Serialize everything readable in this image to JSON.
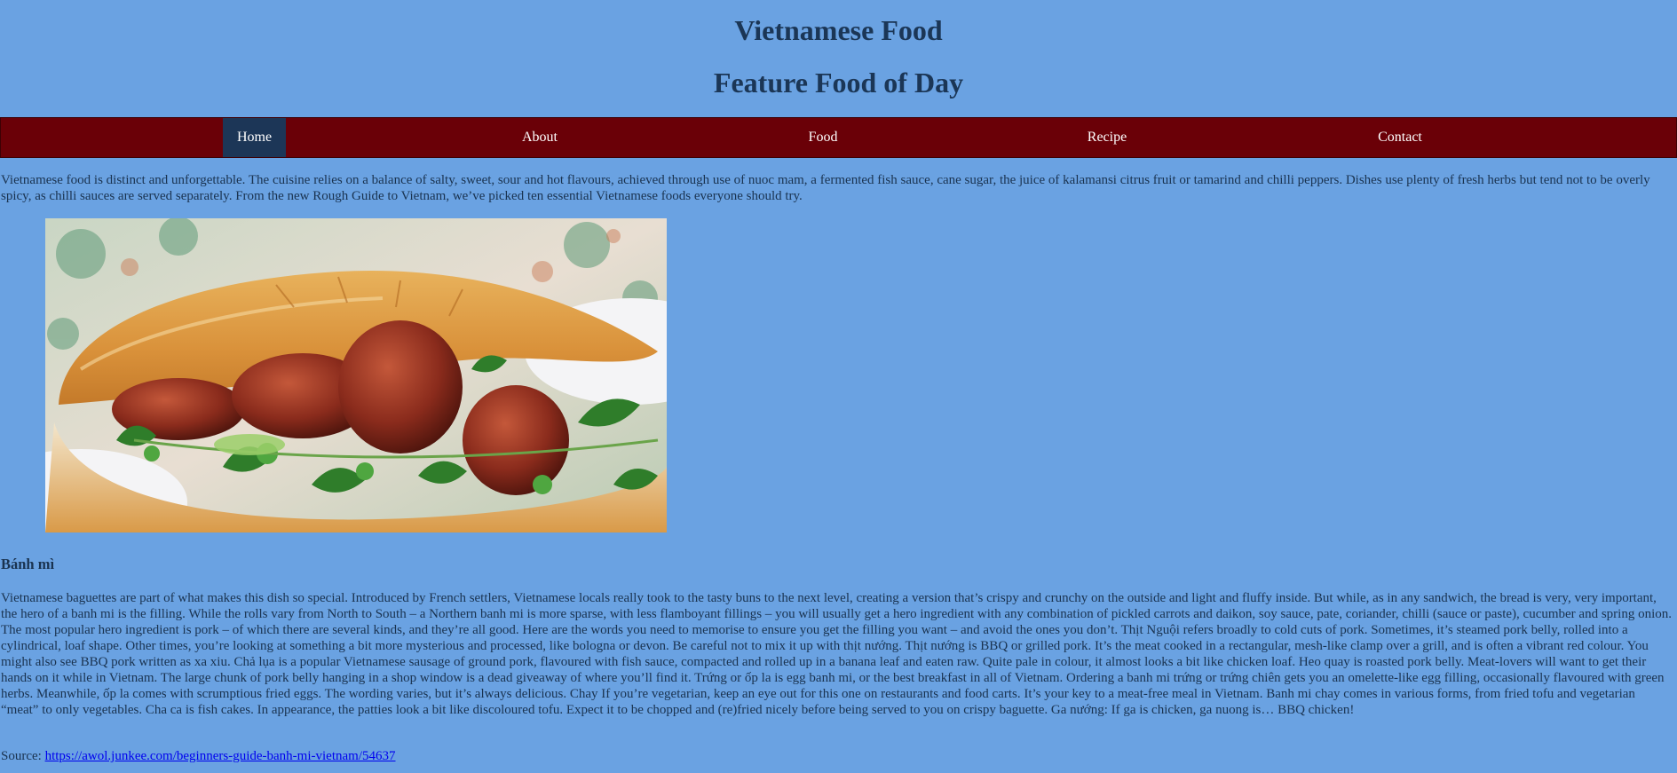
{
  "header": {
    "title": "Vietnamese Food",
    "subtitle": "Feature Food of Day"
  },
  "nav": {
    "items": [
      {
        "label": "Home",
        "active": true
      },
      {
        "label": "About",
        "active": false
      },
      {
        "label": "Food",
        "active": false
      },
      {
        "label": "Recipe",
        "active": false
      },
      {
        "label": "Contact",
        "active": false
      }
    ]
  },
  "intro": "Vietnamese food is distinct and unforgettable. The cuisine relies on a balance of salty, sweet, sour and hot flavours, achieved through use of nuoc mam, a fermented fish sauce, cane sugar, the juice of kalamansi citrus fruit or tamarind and chilli peppers. Dishes use plenty of fresh herbs but tend not to be overly spicy, as chilli sauces are served separately. From the new Rough Guide to Vietnam, we’ve picked ten essential Vietnamese foods everyone should try.",
  "dish": {
    "name": "Bánh mì",
    "description": "Vietnamese baguettes are part of what makes this dish so special. Introduced by French settlers, Vietnamese locals really took to the tasty buns to the next level, creating a version that’s crispy and crunchy on the outside and light and fluffy inside. But while, as in any sandwich, the bread is very, very important, the hero of a banh mi is the filling. While the rolls vary from North to South – a Northern banh mi is more sparse, with less flamboyant fillings – you will usually get a hero ingredient with any combination of pickled carrots and daikon, soy sauce, pate, coriander, chilli (sauce or paste), cucumber and spring onion. The most popular hero ingredient is pork – of which there are several kinds, and they’re all good. Here are the words you need to memorise to ensure you get the filling you want – and avoid the ones you don’t. Thịt Nguội refers broadly to cold cuts of pork. Sometimes, it’s steamed pork belly, rolled into a cylindrical, loaf shape. Other times, you’re looking at something a bit more mysterious and processed, like bologna or devon. Be careful not to mix it up with thịt nướng. Thịt nướng is BBQ or grilled pork. It’s the meat cooked in a rectangular, mesh-like clamp over a grill, and is often a vibrant red colour. You might also see BBQ pork written as xa xiu. Chả lụa is a popular Vietnamese sausage of ground pork, flavoured with fish sauce, compacted and rolled up in a banana leaf and eaten raw. Quite pale in colour, it almost looks a bit like chicken loaf. Heo quay is roasted pork belly. Meat-lovers will want to get their hands on it while in Vietnam. The large chunk of pork belly hanging in a shop window is a dead giveaway of where you’ll find it. Trứng or ốp la is egg banh mi, or the best breakfast in all of Vietnam. Ordering a banh mi trứng or trứng chiên gets you an omelette-like egg filling, occasionally flavoured with green herbs. Meanwhile, ốp la comes with scrumptious fried eggs. The wording varies, but it’s always delicious. Chay If you’re vegetarian, keep an eye out for this one on restaurants and food carts. It’s your key to a meat-free meal in Vietnam. Banh mi chay comes in various forms, from fried tofu and vegetarian “meat” to only vegetables. Cha ca is fish cakes. In appearance, the patties look a bit like discoloured tofu. Expect it to be chopped and (re)fried nicely before being served to you on crispy baguette. Ga nướng: If ga is chicken, ga nuong is… BBQ chicken!"
  },
  "source": {
    "label": "Source: ",
    "url_text": "https://awol.junkee.com/beginners-guide-banh-mi-vietnam/54637",
    "href": "https://awol.junkee.com/beginners-guide-banh-mi-vietnam/54637"
  },
  "colors": {
    "page_bg": "#6aa2e2",
    "nav_bg": "#6a0007",
    "nav_active_bg": "#1c3657",
    "heading": "#1b3656",
    "link": "#0000ee"
  }
}
